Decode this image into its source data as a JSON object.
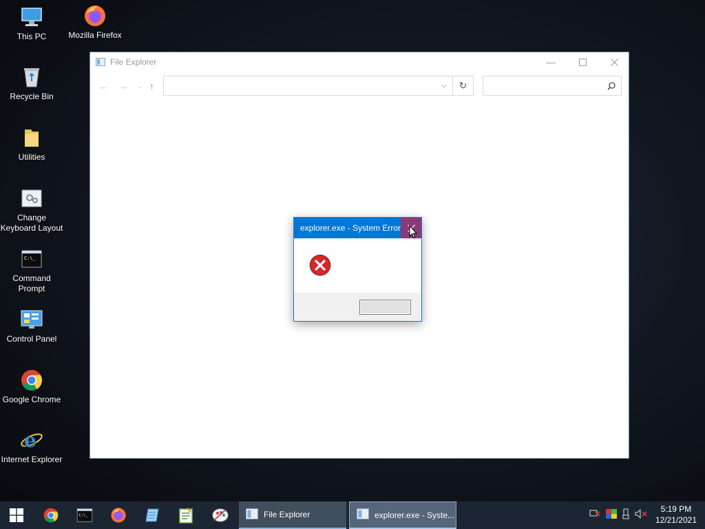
{
  "desktop": {
    "icons": [
      {
        "label": "This PC"
      },
      {
        "label": "Mozilla Firefox"
      },
      {
        "label": "Recycle Bin"
      },
      {
        "label": "Utilities"
      },
      {
        "label": "Change Keyboard Layout"
      },
      {
        "label": "Command Prompt"
      },
      {
        "label": "Control Panel"
      },
      {
        "label": "Google Chrome"
      },
      {
        "label": "Internet Explorer"
      }
    ]
  },
  "file_explorer": {
    "title": "File Explorer",
    "address_value": "",
    "search_placeholder": ""
  },
  "error_dialog": {
    "title": "explorer.exe - System Error",
    "message": "",
    "ok_label": ""
  },
  "taskbar": {
    "items": [
      {
        "label": "File Explorer"
      },
      {
        "label": "explorer.exe - Syste..."
      }
    ],
    "clock_time": "5:19 PM",
    "clock_date": "12/21/2021"
  },
  "colors": {
    "accent": "#0078d7",
    "close_hover": "#8a3a7a",
    "taskbar": "#1c2633"
  }
}
